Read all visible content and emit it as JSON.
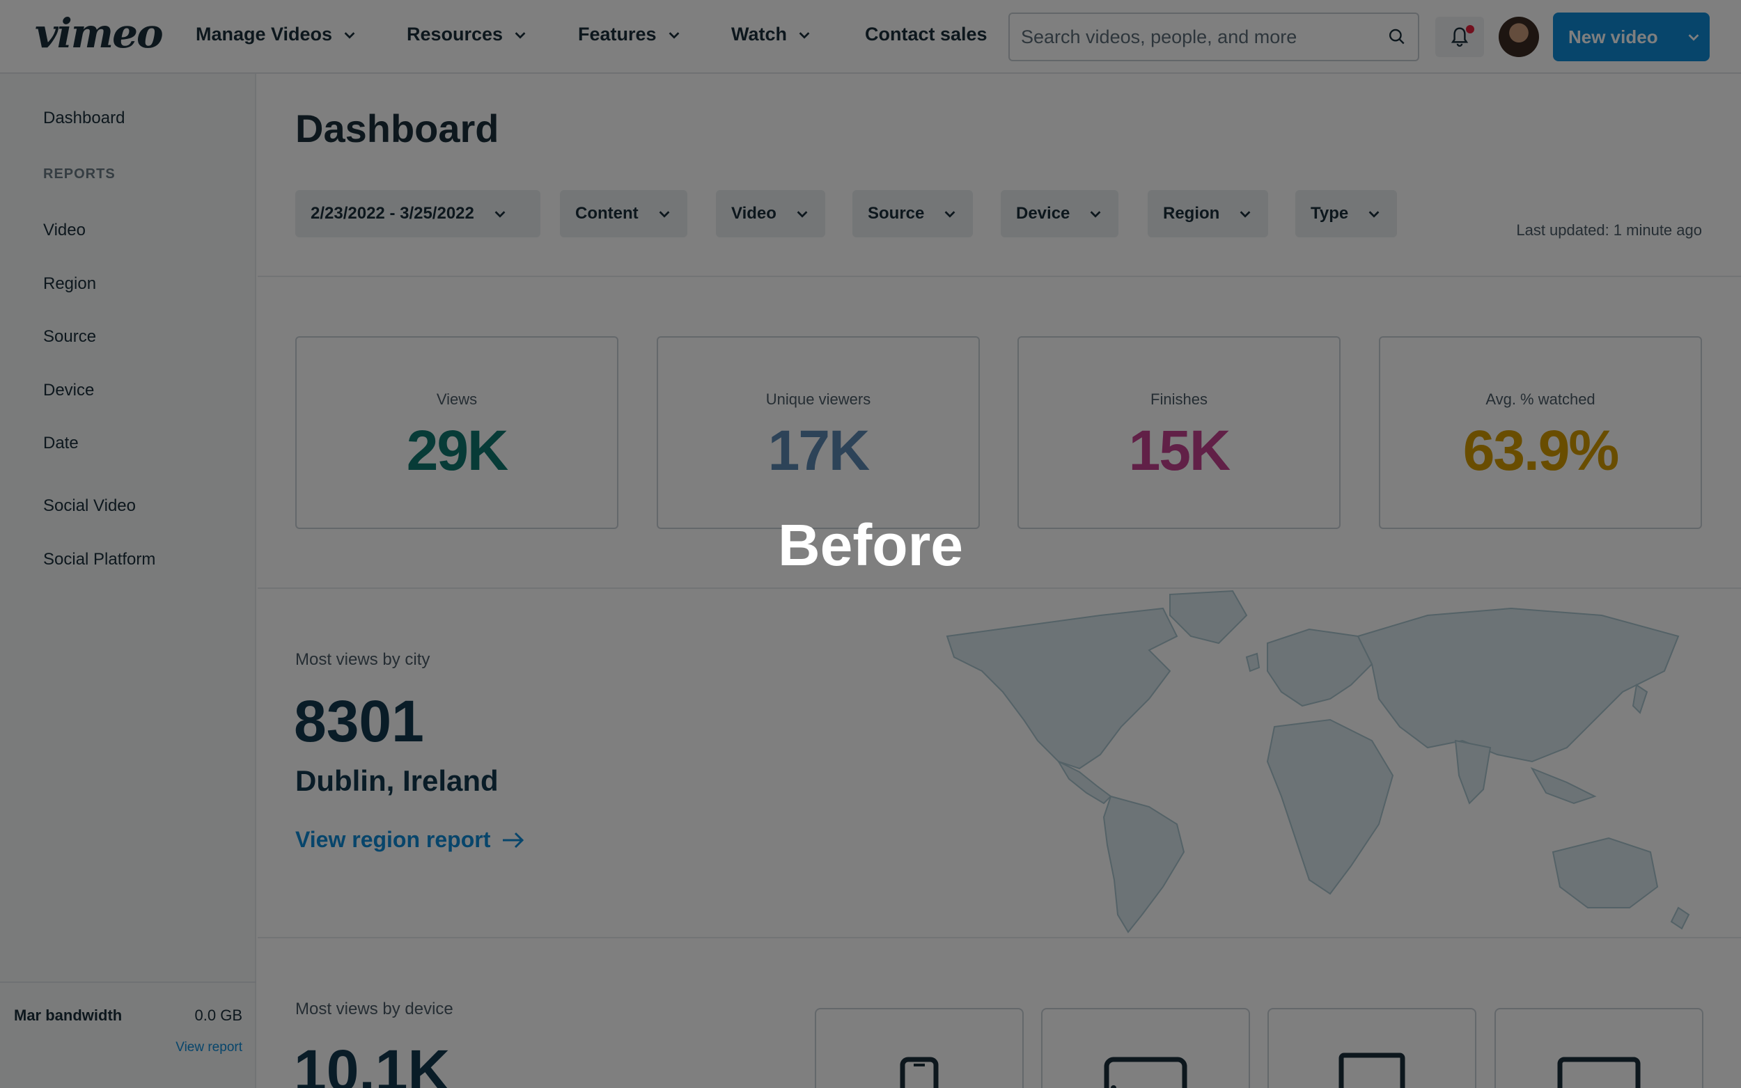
{
  "nav": {
    "logo": "vimeo",
    "items": [
      "Manage Videos",
      "Resources",
      "Features",
      "Watch"
    ],
    "contact": "Contact sales",
    "search_placeholder": "Search videos, people, and more",
    "new_video": "New video"
  },
  "sidebar": {
    "dashboard": "Dashboard",
    "reports_heading": "REPORTS",
    "reports": [
      "Video",
      "Region",
      "Source",
      "Device",
      "Date"
    ],
    "social": [
      "Social Video",
      "Social Platform"
    ],
    "bandwidth_label": "Mar bandwidth",
    "bandwidth_value": "0.0 GB",
    "view_report": "View report"
  },
  "main": {
    "title": "Dashboard",
    "filters": [
      "2/23/2022 - 3/25/2022",
      "Content",
      "Video",
      "Source",
      "Device",
      "Region",
      "Type"
    ],
    "last_updated": "Last updated: 1 minute ago",
    "stats": [
      {
        "label": "Views",
        "value": "29K",
        "color": "#0f766e"
      },
      {
        "label": "Unique viewers",
        "value": "17K",
        "color": "#5b86b0"
      },
      {
        "label": "Finishes",
        "value": "15K",
        "color": "#c2418f"
      },
      {
        "label": "Avg. % watched",
        "value": "63.9%",
        "color": "#d39a00"
      }
    ],
    "city_section": {
      "label": "Most views by city",
      "value": "8301",
      "city": "Dublin, Ireland",
      "link": "View region report"
    },
    "device_section": {
      "label": "Most views by device",
      "value": "10.1K"
    }
  },
  "overlay": {
    "caption": "Before"
  }
}
